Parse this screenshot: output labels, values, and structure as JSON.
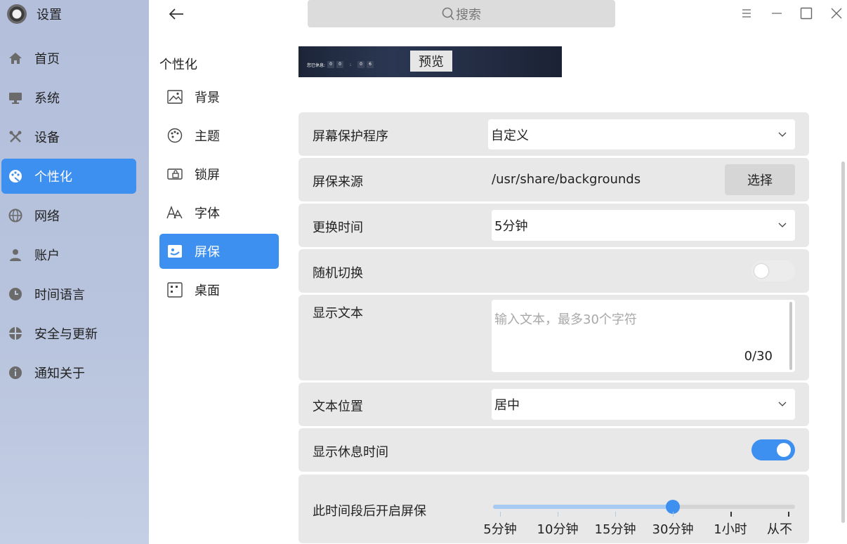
{
  "app": {
    "title": "设置",
    "logo_icon": "gear-icon"
  },
  "sidebar": {
    "items": [
      {
        "label": "首页",
        "icon": "home-icon",
        "active": false
      },
      {
        "label": "系统",
        "icon": "monitor-icon",
        "active": false
      },
      {
        "label": "设备",
        "icon": "tools-icon",
        "active": false
      },
      {
        "label": "个性化",
        "icon": "palette-icon",
        "active": true
      },
      {
        "label": "网络",
        "icon": "globe-icon",
        "active": false
      },
      {
        "label": "账户",
        "icon": "user-icon",
        "active": false
      },
      {
        "label": "时间语言",
        "icon": "clock-icon",
        "active": false
      },
      {
        "label": "安全与更新",
        "icon": "shield-icon",
        "active": false
      },
      {
        "label": "通知关于",
        "icon": "info-icon",
        "active": false
      }
    ]
  },
  "topbar": {
    "search_placeholder": "搜索"
  },
  "subnav": {
    "title": "个性化",
    "items": [
      {
        "label": "背景",
        "icon": "image-icon",
        "active": false
      },
      {
        "label": "主题",
        "icon": "palette-outline-icon",
        "active": false
      },
      {
        "label": "锁屏",
        "icon": "lockscreen-icon",
        "active": false
      },
      {
        "label": "字体",
        "icon": "font-icon",
        "active": false
      },
      {
        "label": "屏保",
        "icon": "screensaver-icon",
        "active": true
      },
      {
        "label": "桌面",
        "icon": "desktop-grid-icon",
        "active": false
      }
    ]
  },
  "preview": {
    "clock_label": "您已休息:",
    "clock_digits": [
      "0",
      "0",
      "0",
      "6"
    ],
    "clock_sep": ":",
    "button_label": "预览"
  },
  "settings": {
    "screensaver": {
      "label": "屏幕保护程序",
      "value": "自定义"
    },
    "source": {
      "label": "屏保来源",
      "path": "/usr/share/backgrounds",
      "button": "选择"
    },
    "interval": {
      "label": "更换时间",
      "value": "5分钟"
    },
    "random": {
      "label": "随机切换",
      "enabled": false
    },
    "text": {
      "label": "显示文本",
      "placeholder": "输入文本，最多30个字符",
      "counter": "0/30"
    },
    "text_position": {
      "label": "文本位置",
      "value": "居中"
    },
    "show_rest_time": {
      "label": "显示休息时间",
      "enabled": true
    },
    "idle": {
      "label": "此时间段后开启屏保",
      "options": [
        "5分钟",
        "10分钟",
        "15分钟",
        "30分钟",
        "1小时",
        "从不"
      ],
      "selected": "30分钟",
      "selected_index": 3
    }
  },
  "colors": {
    "accent": "#3d8ff0",
    "row_bg": "#e8e8e8",
    "sidebar_bg": "#b5c1dc"
  }
}
